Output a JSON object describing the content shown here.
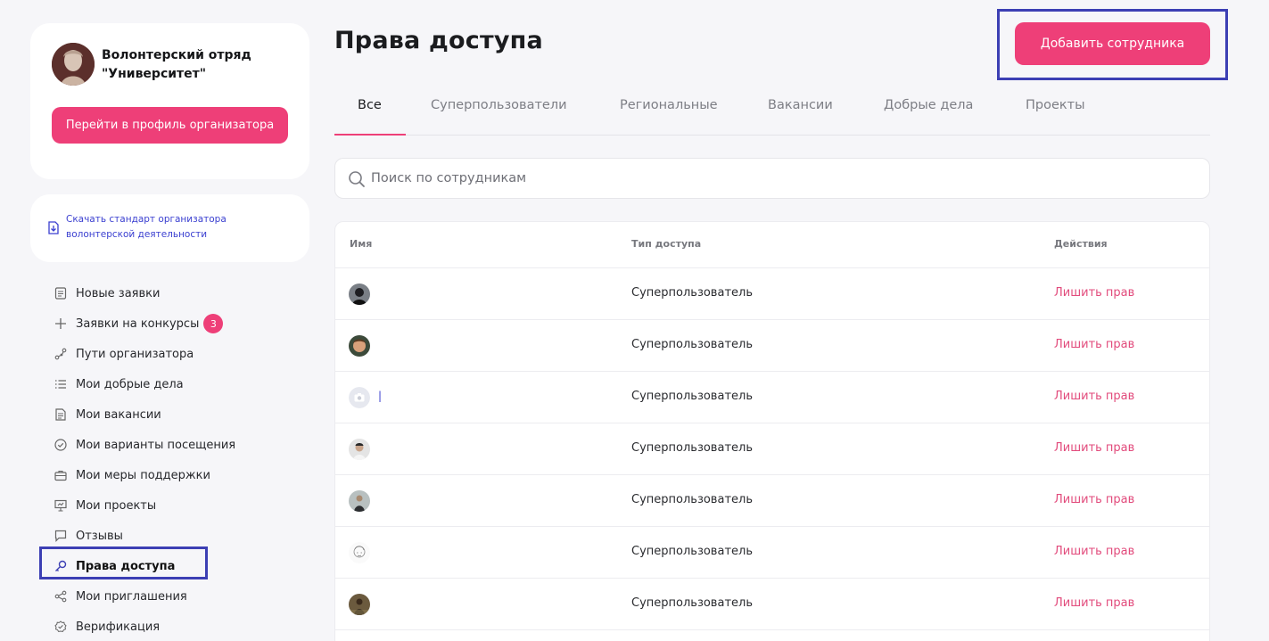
{
  "sidebar": {
    "org_name": "Волонтерский отряд \"Университет\"",
    "profile_button": "Перейти в профиль организатора",
    "download_link": "Скачать стандарт организатора волонтерской деятельности",
    "nav": [
      {
        "label": "Новые заявки",
        "icon": "document-list-icon"
      },
      {
        "label": "Заявки на конкурсы",
        "icon": "plus-icon",
        "badge": "3"
      },
      {
        "label": "Пути организатора",
        "icon": "route-icon"
      },
      {
        "label": "Мои добрые дела",
        "icon": "list-icon"
      },
      {
        "label": "Мои вакансии",
        "icon": "document-icon"
      },
      {
        "label": "Мои варианты посещения",
        "icon": "check-circle-icon"
      },
      {
        "label": "Мои меры поддержки",
        "icon": "briefcase-icon"
      },
      {
        "label": "Мои проекты",
        "icon": "presentation-icon"
      },
      {
        "label": "Отзывы",
        "icon": "chat-icon"
      },
      {
        "label": "Права доступа",
        "icon": "key-icon",
        "active": true
      },
      {
        "label": "Мои приглашения",
        "icon": "share-icon"
      },
      {
        "label": "Верификация",
        "icon": "verified-icon"
      }
    ]
  },
  "header": {
    "title": "Права доступа",
    "add_button": "Добавить сотрудника"
  },
  "tabs": [
    {
      "label": "Все",
      "active": true
    },
    {
      "label": "Суперпользователи"
    },
    {
      "label": "Региональные"
    },
    {
      "label": "Вакансии"
    },
    {
      "label": "Добрые дела"
    },
    {
      "label": "Проекты"
    }
  ],
  "search": {
    "placeholder": "Поиск по сотрудникам"
  },
  "table": {
    "columns": [
      "Имя",
      "Тип доступа",
      "Действия"
    ],
    "rows": [
      {
        "name": "",
        "type": "Суперпользователь",
        "action": "Лишить прав",
        "avatar": "photo-dark"
      },
      {
        "name": "",
        "type": "Суперпользователь",
        "action": "Лишить прав",
        "avatar": "photo-man"
      },
      {
        "name": "|",
        "type": "Суперпользователь",
        "action": "Лишить прав",
        "avatar": "placeholder-camera"
      },
      {
        "name": "",
        "type": "Суперпользователь",
        "action": "Лишить прав",
        "avatar": "photo-light"
      },
      {
        "name": "",
        "type": "Суперпользователь",
        "action": "Лишить прав",
        "avatar": "photo-outdoor"
      },
      {
        "name": "",
        "type": "Суперпользователь",
        "action": "Лишить прав",
        "avatar": "sketch"
      },
      {
        "name": "",
        "type": "Суперпользователь",
        "action": "Лишить прав",
        "avatar": "photo-brown"
      }
    ]
  },
  "colors": {
    "accent": "#ee3f78",
    "link": "#3a3fd0",
    "highlight": "#3c3fb4"
  }
}
